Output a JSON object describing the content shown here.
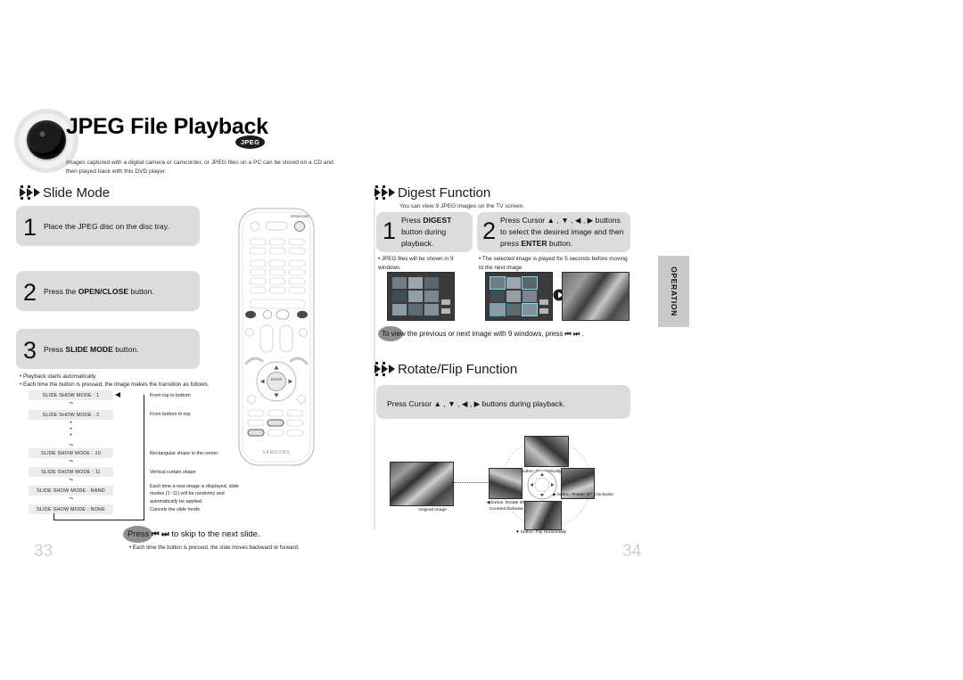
{
  "document": {
    "chapter_title": "JPEG File Playback",
    "chapter_badge": "JPEG",
    "chapter_subtitle": "Images captured with a digital camera or camcorder, or JPEG files on a PC can be stored on a CD and then played back with this DVD player.",
    "side_tab": "OPERATION",
    "page_left": "33",
    "page_right": "34"
  },
  "slide_mode": {
    "heading": "Slide Mode",
    "steps": [
      {
        "num": "1",
        "text_plain": "Place the JPEG disc on the disc tray.",
        "pre": "Place the JPEG disc on the disc tray.",
        "bold": "",
        "post": ""
      },
      {
        "num": "2",
        "text_plain": "Press the OPEN/CLOSE button.",
        "pre": "Press the ",
        "bold": "OPEN/CLOSE",
        "post": " button."
      },
      {
        "num": "3",
        "text_plain": "Press SLIDE MODE button.",
        "pre": "Press ",
        "bold": "SLIDE MODE",
        "post": " button."
      }
    ],
    "notes": [
      "• Playback starts automatically.",
      "• Each time the button is pressed, the image makes the transition as follows."
    ],
    "flow": [
      {
        "label": "SLIDE SHOW MODE : 1",
        "desc": "From top to bottom"
      },
      {
        "label": "SLIDE SHOW MODE : 2",
        "desc": "From bottom to top"
      },
      {
        "label": "SLIDE SHOW MODE : 10",
        "desc": "Rectangular shape in the center"
      },
      {
        "label": "SLIDE SHOW MODE : 11",
        "desc": "Vertical curtain shape"
      },
      {
        "label": "SLIDE SHOW MODE : RAND",
        "desc": "Each time a new image is displayed, slide modes (1~11) will be randomly and automatically be applied."
      },
      {
        "label": "SLIDE SHOW MODE : NONE",
        "desc": "Cancels the slide mode."
      }
    ],
    "press_note": {
      "pre": "Press ",
      "icon": "⏮ ⏭",
      "post": " to skip to the next slide."
    },
    "press_subnote": "• Each time the button is pressed, the slide moves backward or forward."
  },
  "digest": {
    "heading": "Digest Function",
    "subtitle": "You can view 9 JPEG images on the TV screen.",
    "steps": [
      {
        "num": "1",
        "pre": "Press ",
        "bold": "DIGEST",
        "post": " button during playback.",
        "note": "• JPEG files will be shown in 9 windows."
      },
      {
        "num": "2",
        "pre": "Press Cursor ▲ , ▼ , ◀ , ▶ buttons to select the desired image and then press ",
        "bold": "ENTER",
        "post": " button.",
        "note": "• The selected image is played for 5 seconds before moving to the next image."
      }
    ],
    "footer": {
      "pre": "To view the previous or next image with 9 windows, press ",
      "icon": "⏮ ⏭",
      "post": " ."
    }
  },
  "rotate_flip": {
    "heading": "Rotate/Flip Function",
    "instruction": "Press Cursor ▲ , ▼ , ◀ , ▶  buttons during playback.",
    "original_caption": "Original Image",
    "labels": {
      "up": "▲ button: Flip Vertically",
      "down": "▼ button: Flip Horizontally",
      "left": "◀ button: Rotate 90° Counterclockwise",
      "right": "▶ button: Rotate 90° Clockwise"
    }
  },
  "remote": {
    "brand": "SAMSUNG",
    "open_close_label": "OPEN/CLOSE",
    "enter_label": "ENTER"
  },
  "colors": {
    "step_box": "#dcdcdc",
    "flow_box": "#ececec",
    "pill": "#8f8f8f",
    "tab": "#c9c9c9",
    "page_number": "#cfcfcf"
  }
}
